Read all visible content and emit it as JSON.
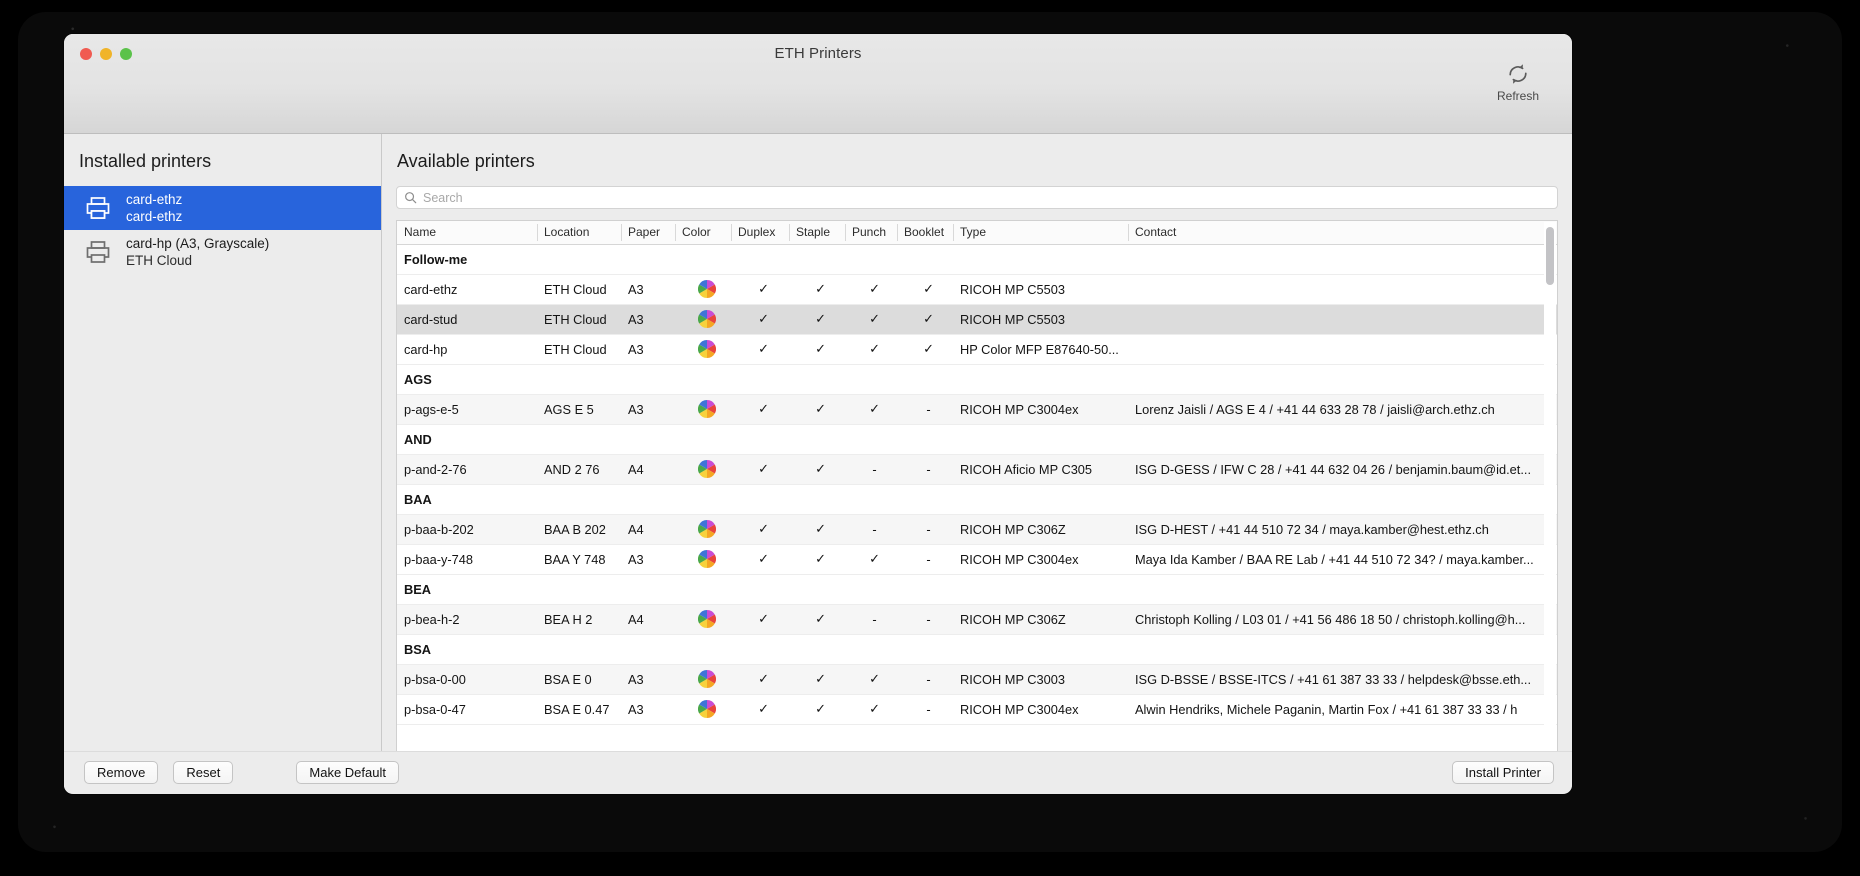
{
  "window": {
    "title": "ETH Printers",
    "traffic_lights": [
      "close",
      "minimize",
      "zoom"
    ]
  },
  "toolbar": {
    "refresh_label": "Refresh",
    "refresh_icon": "refresh-circular-arrows-icon"
  },
  "sidebar": {
    "heading": "Installed printers",
    "items": [
      {
        "icon": "printer-icon",
        "name": "card-ethz",
        "subtitle": "card-ethz",
        "selected": true
      },
      {
        "icon": "printer-icon",
        "name": "card-hp (A3, Grayscale)",
        "subtitle": "ETH Cloud",
        "selected": false
      }
    ]
  },
  "main": {
    "heading": "Available printers",
    "search": {
      "placeholder": "Search",
      "value": "",
      "icon": "search-icon"
    },
    "columns": [
      "Name",
      "Location",
      "Paper",
      "Color",
      "Duplex",
      "Staple",
      "Punch",
      "Booklet",
      "Type",
      "Contact"
    ],
    "rows": [
      {
        "kind": "group",
        "label": "Follow-me"
      },
      {
        "kind": "printer",
        "name": "card-ethz",
        "location": "ETH Cloud",
        "paper": "A3",
        "color": "color-wheel-icon",
        "duplex": "✓",
        "staple": "✓",
        "punch": "✓",
        "booklet": "✓",
        "type": "RICOH MP C5503",
        "contact": "",
        "style": "plain"
      },
      {
        "kind": "printer",
        "name": "card-stud",
        "location": "ETH Cloud",
        "paper": "A3",
        "color": "color-wheel-icon",
        "duplex": "✓",
        "staple": "✓",
        "punch": "✓",
        "booklet": "✓",
        "type": "RICOH MP C5503",
        "contact": "",
        "style": "selected"
      },
      {
        "kind": "printer",
        "name": "card-hp",
        "location": "ETH Cloud",
        "paper": "A3",
        "color": "color-wheel-icon",
        "duplex": "✓",
        "staple": "✓",
        "punch": "✓",
        "booklet": "✓",
        "type": "HP Color MFP E87640-50...",
        "contact": "",
        "style": "plain"
      },
      {
        "kind": "group",
        "label": "AGS"
      },
      {
        "kind": "printer",
        "name": "p-ags-e-5",
        "location": "AGS E 5",
        "paper": "A3",
        "color": "color-wheel-icon",
        "duplex": "✓",
        "staple": "✓",
        "punch": "✓",
        "booklet": "-",
        "type": "RICOH MP C3004ex",
        "contact": "Lorenz Jaisli / AGS E 4 / +41 44 633 28 78 / jaisli@arch.ethz.ch",
        "style": "zebra"
      },
      {
        "kind": "group",
        "label": "AND"
      },
      {
        "kind": "printer",
        "name": "p-and-2-76",
        "location": "AND 2 76",
        "paper": "A4",
        "color": "color-wheel-icon",
        "duplex": "✓",
        "staple": "✓",
        "punch": "-",
        "booklet": "-",
        "type": "RICOH Aficio MP C305",
        "contact": "ISG D-GESS / IFW C 28 / +41 44 632 04 26 / benjamin.baum@id.et...",
        "style": "zebra"
      },
      {
        "kind": "group",
        "label": "BAA"
      },
      {
        "kind": "printer",
        "name": "p-baa-b-202",
        "location": "BAA B 202",
        "paper": "A4",
        "color": "color-wheel-icon",
        "duplex": "✓",
        "staple": "✓",
        "punch": "-",
        "booklet": "-",
        "type": "RICOH MP C306Z",
        "contact": "ISG D-HEST / +41 44 510 72 34  / maya.kamber@hest.ethz.ch",
        "style": "zebra"
      },
      {
        "kind": "printer",
        "name": "p-baa-y-748",
        "location": "BAA Y 748",
        "paper": "A3",
        "color": "color-wheel-icon",
        "duplex": "✓",
        "staple": "✓",
        "punch": "✓",
        "booklet": "-",
        "type": "RICOH MP C3004ex",
        "contact": "Maya Ida Kamber / BAA RE Lab / +41 44 510 72 34? / maya.kamber...",
        "style": "plain"
      },
      {
        "kind": "group",
        "label": "BEA"
      },
      {
        "kind": "printer",
        "name": "p-bea-h-2",
        "location": "BEA H 2",
        "paper": "A4",
        "color": "color-wheel-icon",
        "duplex": "✓",
        "staple": "✓",
        "punch": "-",
        "booklet": "-",
        "type": "RICOH MP C306Z",
        "contact": "Christoph Kolling / L03 01 / +41 56 486 18 50 / christoph.kolling@h...",
        "style": "zebra"
      },
      {
        "kind": "group",
        "label": "BSA"
      },
      {
        "kind": "printer",
        "name": "p-bsa-0-00",
        "location": "BSA E 0",
        "paper": "A3",
        "color": "color-wheel-icon",
        "duplex": "✓",
        "staple": "✓",
        "punch": "✓",
        "booklet": "-",
        "type": "RICOH MP C3003",
        "contact": "ISG D-BSSE / BSSE-ITCS / +41 61 387 33 33 / helpdesk@bsse.eth...",
        "style": "zebra"
      },
      {
        "kind": "printer",
        "name": "p-bsa-0-47",
        "location": "BSA E 0.47",
        "paper": "A3",
        "color": "color-wheel-icon",
        "duplex": "✓",
        "staple": "✓",
        "punch": "✓",
        "booklet": "-",
        "type": "RICOH MP C3004ex",
        "contact": "Alwin Hendriks, Michele Paganin, Martin Fox / +41 61 387 33 33 / h",
        "style": "plain"
      }
    ]
  },
  "footer": {
    "remove_label": "Remove",
    "reset_label": "Reset",
    "make_default_label": "Make Default",
    "install_label": "Install Printer"
  },
  "colors": {
    "selection_blue": "#2864dc",
    "window_bg": "#ececec",
    "table_bg": "#ffffff"
  }
}
